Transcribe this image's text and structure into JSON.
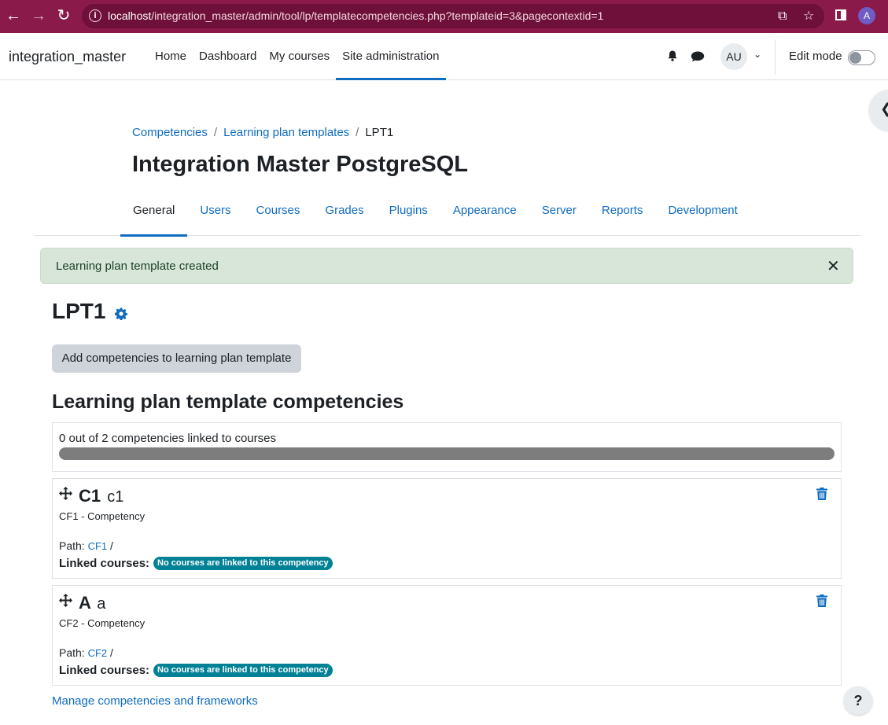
{
  "browser": {
    "url_host": "localhost",
    "url_path": "/integration_master/admin/tool/lp/templatecompetencies.php?templateid=3&pagecontextid=1",
    "profile_initial": "A",
    "info_icon": "i"
  },
  "navbar": {
    "brand": "integration_master",
    "items": [
      {
        "label": "Home"
      },
      {
        "label": "Dashboard"
      },
      {
        "label": "My courses"
      },
      {
        "label": "Site administration"
      }
    ],
    "user_initials": "AU",
    "edit_mode_label": "Edit mode"
  },
  "breadcrumb": {
    "items": [
      "Competencies",
      "Learning plan templates"
    ],
    "separator": "/",
    "current": "LPT1"
  },
  "page_title": "Integration Master PostgreSQL",
  "secondary_nav": {
    "tabs": [
      {
        "label": "General"
      },
      {
        "label": "Users"
      },
      {
        "label": "Courses"
      },
      {
        "label": "Grades"
      },
      {
        "label": "Plugins"
      },
      {
        "label": "Appearance"
      },
      {
        "label": "Server"
      },
      {
        "label": "Reports"
      },
      {
        "label": "Development"
      }
    ]
  },
  "alert": {
    "message": "Learning plan template created",
    "close_symbol": "✕"
  },
  "template_name": "LPT1",
  "add_button_label": "Add competencies to learning plan template",
  "section_title": "Learning plan template competencies",
  "progress": {
    "text": "0 out of 2 competencies linked to courses",
    "fraction": 0
  },
  "competencies": [
    {
      "code": "C1",
      "name": "c1",
      "framework": "CF1 - Competency",
      "path_label": "Path:",
      "path_link": "CF1",
      "path_sep": "/",
      "linked_label": "Linked courses:",
      "linked_badge": "No courses are linked to this competency"
    },
    {
      "code": "A",
      "name": "a",
      "framework": "CF2 - Competency",
      "path_label": "Path:",
      "path_link": "CF2",
      "path_sep": "/",
      "linked_label": "Linked courses:",
      "linked_badge": "No courses are linked to this competency"
    }
  ],
  "manage_link": "Manage competencies and frameworks",
  "help_symbol": "?",
  "colors": {
    "chrome": "#8a1a4a",
    "link": "#0f6cbf",
    "alert_bg": "#d7e6d9",
    "badge": "#008196",
    "progress_track": "#7d7d7d"
  }
}
